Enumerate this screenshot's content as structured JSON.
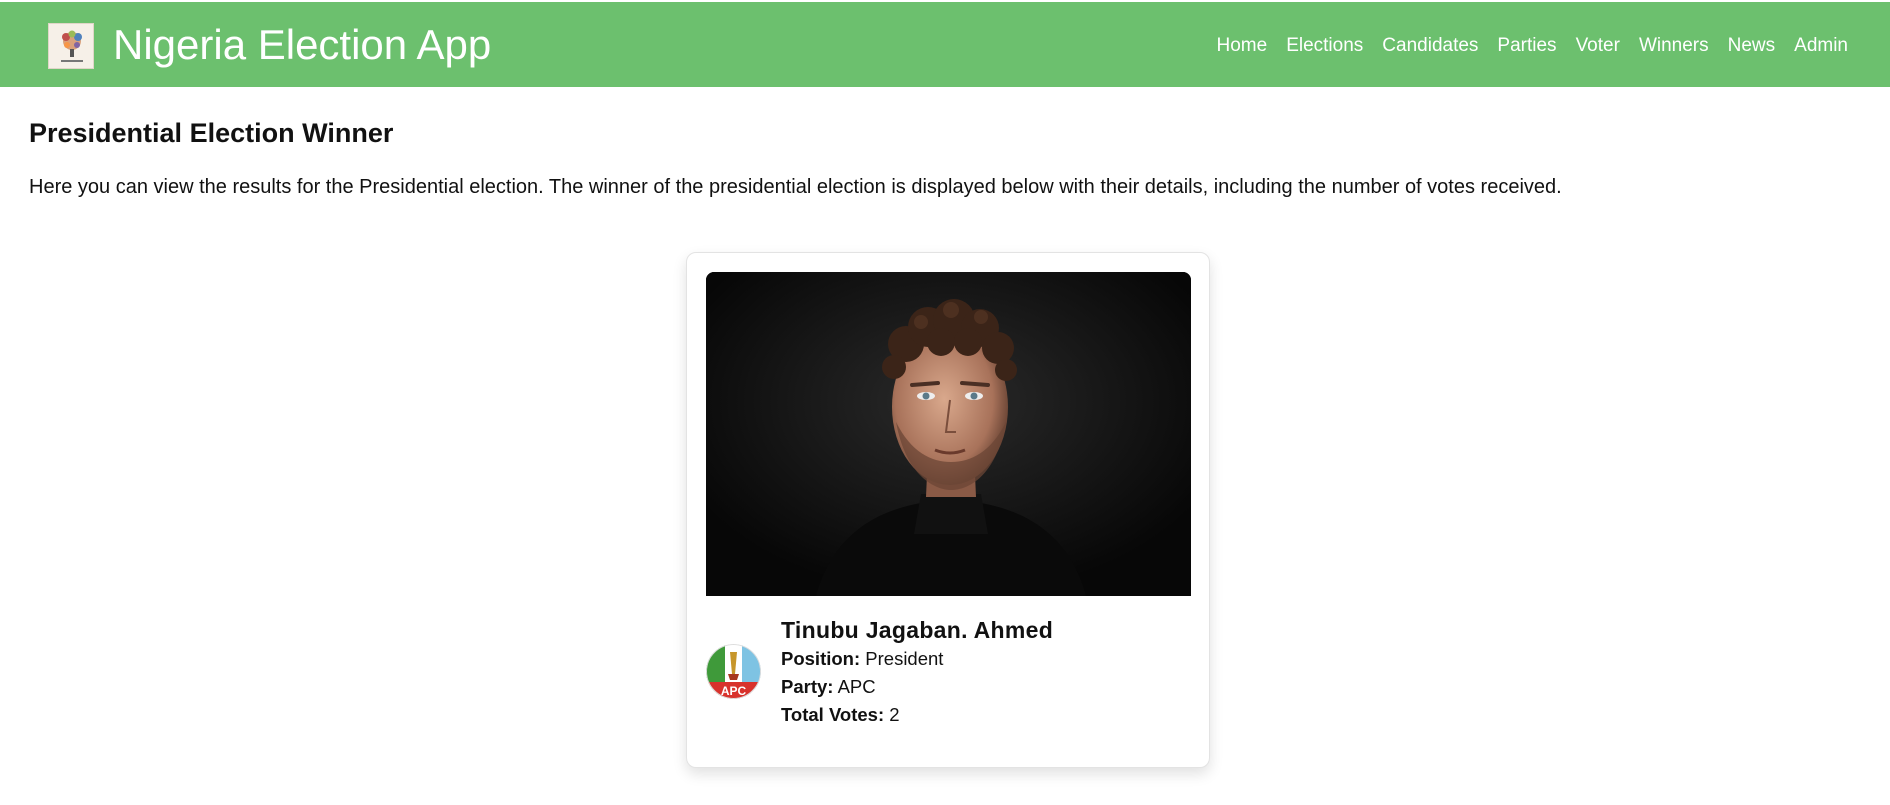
{
  "header": {
    "app_title": "Nigeria Election App",
    "logo_icon": "election-logo-icon",
    "nav": [
      {
        "label": "Home"
      },
      {
        "label": "Elections"
      },
      {
        "label": "Candidates"
      },
      {
        "label": "Parties"
      },
      {
        "label": "Voter"
      },
      {
        "label": "Winners"
      },
      {
        "label": "News"
      },
      {
        "label": "Admin"
      }
    ],
    "bg_color": "#6cc06e"
  },
  "main": {
    "heading": "Presidential Election Winner",
    "intro": "Here you can view the results for the Presidential election. The winner of the presidential election is displayed below with their details, including the number of votes received."
  },
  "winner": {
    "name": "Tinubu Jagaban. Ahmed",
    "position_label": "Position:",
    "position": "President",
    "party_label": "Party:",
    "party": "APC",
    "votes_label": "Total Votes:",
    "votes": "2",
    "party_logo_text": "APC"
  }
}
